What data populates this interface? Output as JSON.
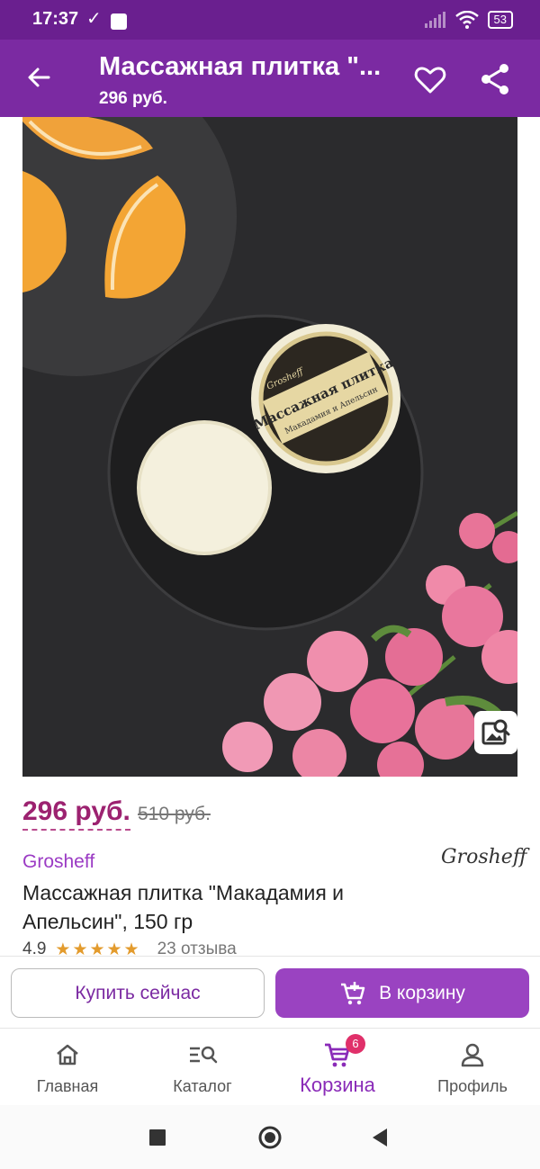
{
  "status_bar": {
    "time": "17:37",
    "battery": "53"
  },
  "app_bar": {
    "title": "Массажная плитка \"...",
    "subtitle": "296 руб."
  },
  "product": {
    "price": "296 руб.",
    "old_price": "510 руб.",
    "brand": "Grosheff",
    "brand_logo_text": "Grosheff",
    "name": "Массажная плитка \"Макадамия и Апельсин\", 150 гр",
    "rating": "4.9",
    "stars": "★★★★★",
    "reviews": "23 отзыва",
    "image_label_line1": "Массажная плитка",
    "image_label_line2": "Макадамия и Апельсин",
    "image_brand": "Grosheff"
  },
  "actions": {
    "buy_now": "Купить сейчас",
    "add_to_cart": "В корзину"
  },
  "bottom_nav": {
    "items": [
      {
        "label": "Главная",
        "icon": "home-icon"
      },
      {
        "label": "Каталог",
        "icon": "catalog-search-icon"
      },
      {
        "label": "Корзина",
        "icon": "cart-icon",
        "badge": "6",
        "active": true
      },
      {
        "label": "Профиль",
        "icon": "profile-icon"
      }
    ]
  },
  "colors": {
    "app_bar": "#7b2aa2",
    "status_bar": "#6a1f8f",
    "accent": "#9a43c1",
    "price": "#9c2270",
    "badge": "#e0306a"
  }
}
